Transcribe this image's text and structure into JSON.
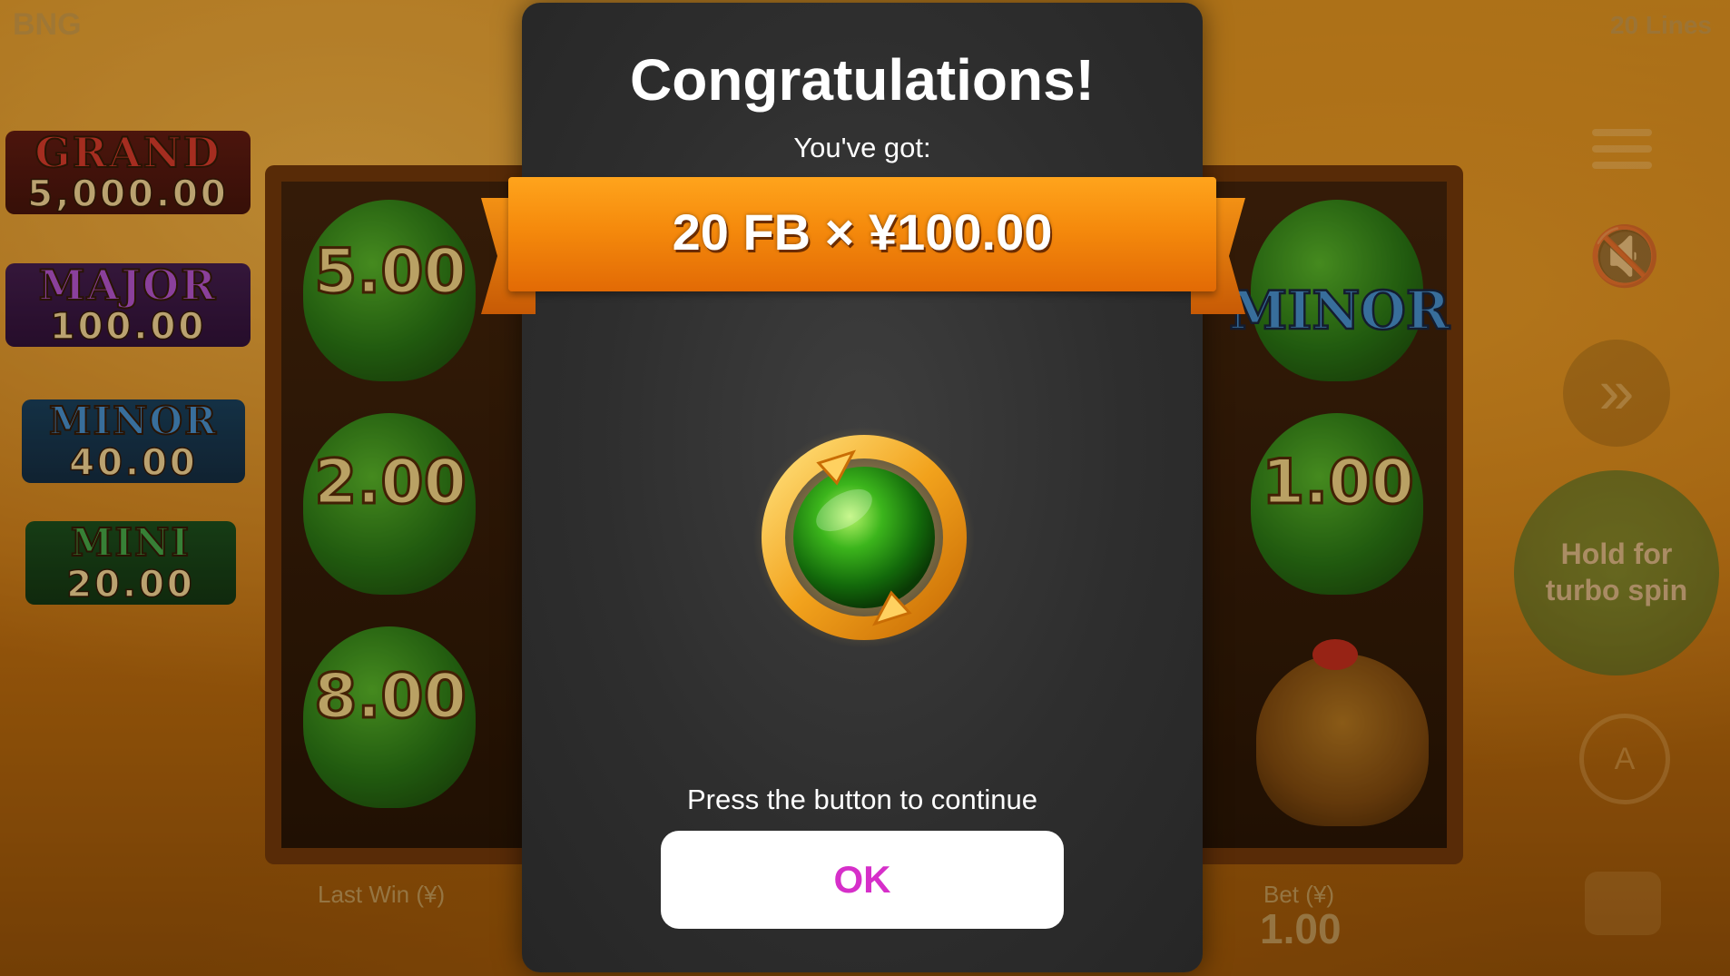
{
  "game": {
    "brand": "BNG",
    "lines": "20 Lines",
    "jackpots": [
      {
        "name": "GRAND",
        "value": "5,000.00"
      },
      {
        "name": "MAJOR",
        "value": "100.00"
      },
      {
        "name": "MINOR",
        "value": "40.00"
      },
      {
        "name": "MINI",
        "value": "20.00"
      }
    ],
    "reels": {
      "left": [
        "5.00",
        "2.00",
        "8.00"
      ],
      "right": [
        "MINOR",
        "1.00"
      ]
    },
    "last_win_label": "Last Win (¥)",
    "bet_label": "Bet (¥)",
    "bet_value": "1.00",
    "spin_hint_line1": "Hold for",
    "spin_hint_line2": "turbo spin"
  },
  "modal": {
    "title": "Congratulations!",
    "subtitle": "You've got:",
    "award": "20 FB × ¥100.00",
    "prompt": "Press the button to continue",
    "ok_label": "OK"
  },
  "colors": {
    "ribbon": "#f58a0c",
    "ok_text": "#d62fc9",
    "modal_bg": "#2e2e2e"
  }
}
